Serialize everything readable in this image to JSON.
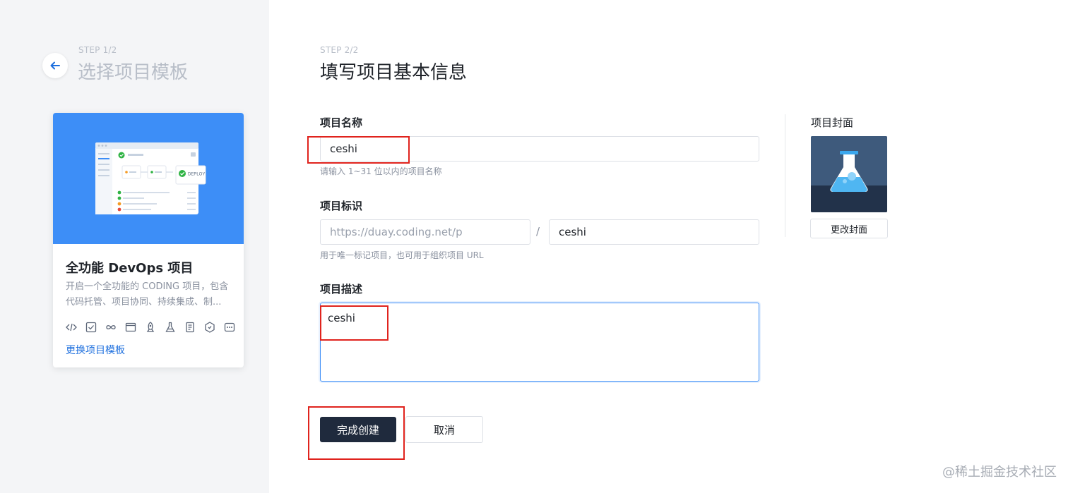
{
  "left": {
    "step": "STEP 1/2",
    "title": "选择项目模板",
    "template": {
      "name": "全功能 DevOps 项目",
      "description": "开启一个全功能的 CODING 项目，包含代码托管、项目协同、持续集成、制...",
      "change_link": "更换项目模板",
      "banner_badge": "DEPLOY",
      "icons": [
        "code-icon",
        "check-square-icon",
        "infinity-icon",
        "window-icon",
        "rocket-icon",
        "flask-icon",
        "document-icon",
        "hexagon-icon",
        "more-icon"
      ]
    }
  },
  "form": {
    "step": "STEP 2/2",
    "title": "填写项目基本信息",
    "name": {
      "label": "项目名称",
      "value": "ceshi",
      "hint": "请输入 1~31 位以内的项目名称"
    },
    "identifier": {
      "label": "项目标识",
      "prefix": "https://duay.coding.net/p",
      "separator": "/",
      "value": "ceshi",
      "hint": "用于唯一标记项目，也可用于组织项目 URL"
    },
    "description": {
      "label": "项目描述",
      "value": "ceshi"
    },
    "cover": {
      "label": "项目封面",
      "change_button": "更改封面"
    },
    "submit_label": "完成创建",
    "cancel_label": "取消"
  },
  "watermark": "@稀土掘金技术社区",
  "colors": {
    "primary_button": "#1f2a3d",
    "link": "#1d6fde",
    "banner": "#3d8ef7",
    "highlight": "#e0231d"
  }
}
